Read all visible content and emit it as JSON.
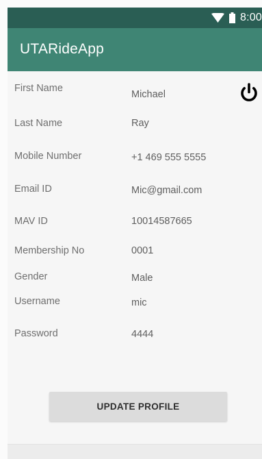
{
  "status_bar": {
    "time": "8:00",
    "wifi_icon": "wifi-icon",
    "battery_icon": "battery-icon"
  },
  "app_bar": {
    "title": "UTARideApp",
    "color": "#3f8574",
    "status_color": "#2a5e54"
  },
  "power_icon": "power-icon",
  "profile": {
    "fields": [
      {
        "label": "First Name",
        "value": "Michael"
      },
      {
        "label": "Last Name",
        "value": "Ray"
      },
      {
        "label": "Mobile Number",
        "value": "+1 469 555 5555"
      },
      {
        "label": "Email ID",
        "value": "Mic@gmail.com"
      },
      {
        "label": "MAV ID",
        "value": "10014587665"
      },
      {
        "label": "Membership No",
        "value": "0001"
      },
      {
        "label": "Gender",
        "value": "Male"
      },
      {
        "label": "Username",
        "value": "mic"
      },
      {
        "label": "Password",
        "value": "4444"
      }
    ]
  },
  "update_button": {
    "label": "UPDATE PROFILE"
  }
}
